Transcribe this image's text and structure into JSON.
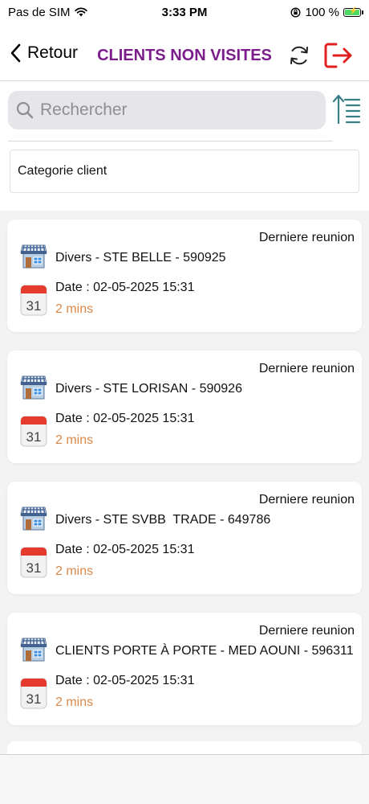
{
  "status_bar": {
    "carrier": "Pas de SIM",
    "time": "3:33 PM",
    "battery": "100 %"
  },
  "nav": {
    "back_label": "Retour",
    "title": "CLIENTS NON VISITES"
  },
  "search": {
    "placeholder": "Rechercher"
  },
  "filter": {
    "category_label": "Categorie client"
  },
  "colors": {
    "title": "#7b1e8c",
    "logout": "#e02020",
    "elapsed": "#d9894a",
    "sort_icon": "#3a7f86"
  },
  "clients": [
    {
      "meeting_label": "Derniere reunion",
      "name": "Divers - STE BELLE - 590925",
      "date": "Date : 02-05-2025 15:31",
      "elapsed": "2 mins",
      "calendar_day": "31"
    },
    {
      "meeting_label": "Derniere reunion",
      "name": "Divers - STE LORISAN - 590926",
      "date": "Date : 02-05-2025 15:31",
      "elapsed": "2 mins",
      "calendar_day": "31"
    },
    {
      "meeting_label": "Derniere reunion",
      "name": "Divers - STE SVBB  TRADE - 649786",
      "date": "Date : 02-05-2025 15:31",
      "elapsed": "2 mins",
      "calendar_day": "31"
    },
    {
      "meeting_label": "Derniere reunion",
      "name": "CLIENTS PORTE À PORTE - MED AOUNI - 596311",
      "date": "Date : 02-05-2025 15:31",
      "elapsed": "2 mins",
      "calendar_day": "31"
    }
  ],
  "icons": {
    "back": "chevron-left-icon",
    "refresh": "refresh-icon",
    "logout": "logout-icon",
    "search": "search-icon",
    "sort": "sort-icon",
    "store": "store-icon",
    "calendar": "calendar-icon"
  }
}
